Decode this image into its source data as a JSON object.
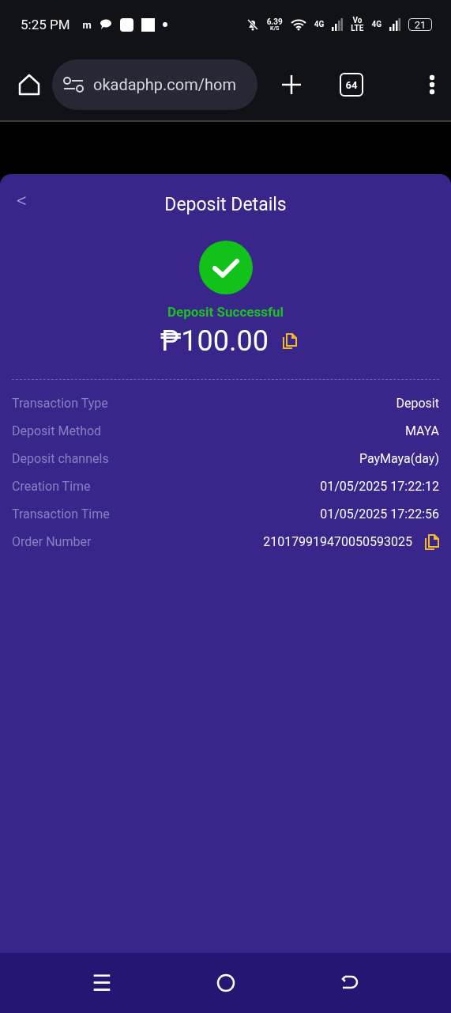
{
  "status_bar": {
    "time": "5:25 PM",
    "app_letter": "m",
    "speed": "6.39",
    "speed_unit": "K/S",
    "sim1": "4G",
    "volte_top": "Vo",
    "volte_bottom": "LTE",
    "sim2": "4G",
    "battery": "21"
  },
  "browser": {
    "url": "okadaphp.com/hom",
    "tab_count": "64"
  },
  "page": {
    "title": "Deposit Details",
    "back": "<",
    "status": "Deposit Successful",
    "amount": "₱100.00",
    "rows": [
      {
        "label": "Transaction Type",
        "value": "Deposit",
        "copyable": false
      },
      {
        "label": "Deposit Method",
        "value": "MAYA",
        "copyable": false
      },
      {
        "label": "Deposit channels",
        "value": "PayMaya(day)",
        "copyable": false
      },
      {
        "label": "Creation Time",
        "value": "01/05/2025 17:22:12",
        "copyable": false
      },
      {
        "label": "Transaction Time",
        "value": "01/05/2025 17:22:56",
        "copyable": false
      },
      {
        "label": "Order Number",
        "value": "210179919470050593025",
        "copyable": true
      }
    ]
  },
  "nav_bar": {
    "menu": "☰"
  }
}
